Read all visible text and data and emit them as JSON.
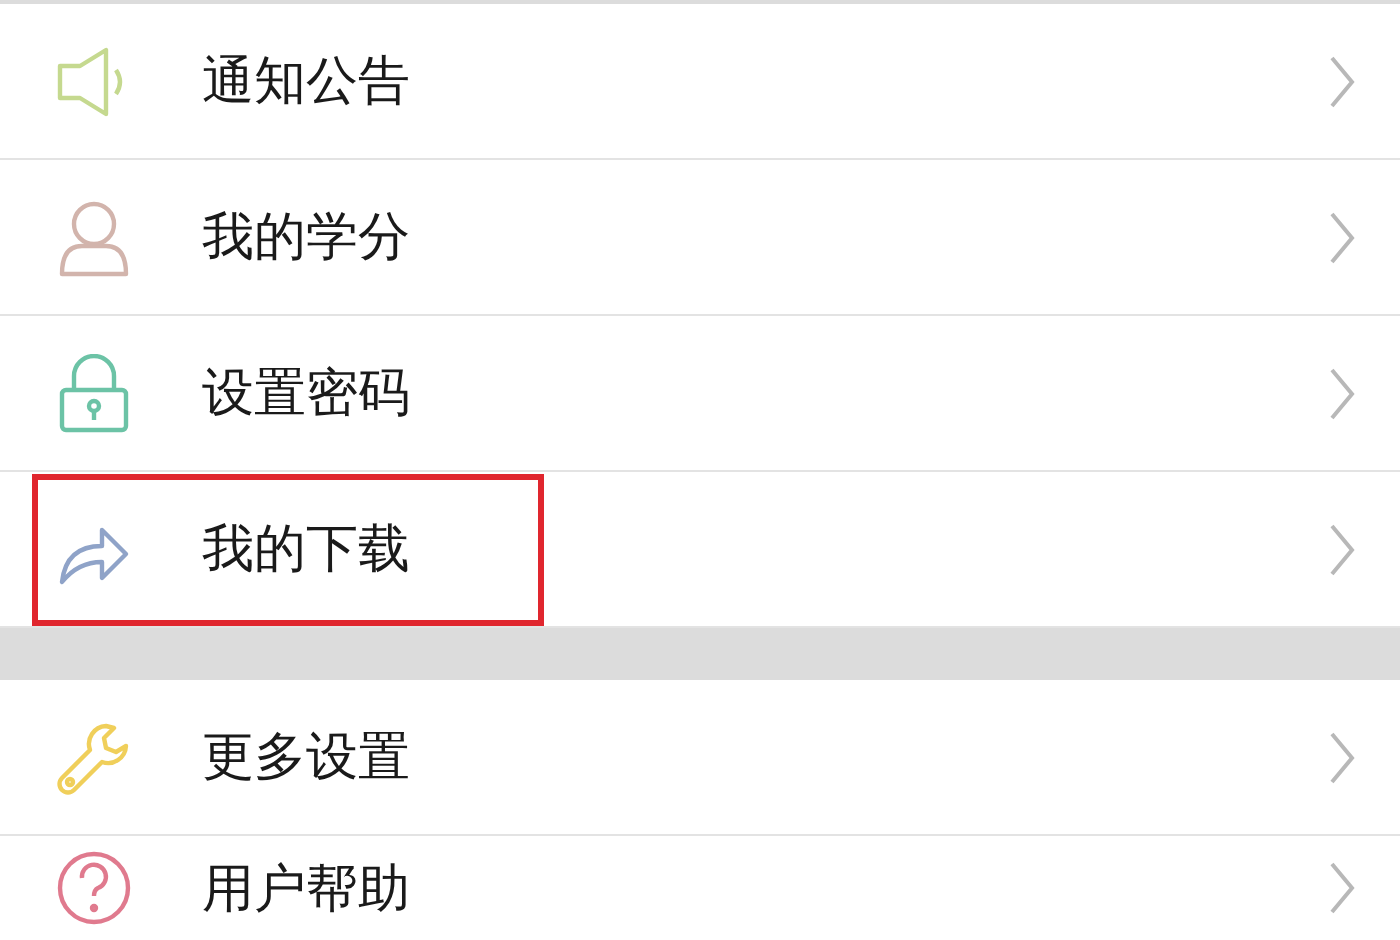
{
  "groups": [
    {
      "items": [
        {
          "kind": "speaker",
          "color": "#c5d98f",
          "label": "通知公告",
          "highlighted": false
        },
        {
          "kind": "person",
          "color": "#d2b4ac",
          "label": "我的学分",
          "highlighted": false
        },
        {
          "kind": "lock",
          "color": "#6cc3a6",
          "label": "设置密码",
          "highlighted": false
        },
        {
          "kind": "share",
          "color": "#8fa3c8",
          "label": "我的下载",
          "highlighted": true
        }
      ]
    },
    {
      "items": [
        {
          "kind": "wrench",
          "color": "#f0cf5a",
          "label": "更多设置",
          "highlighted": false
        },
        {
          "kind": "help",
          "color": "#e07a8e",
          "label": "用户帮助",
          "highlighted": false
        }
      ]
    }
  ]
}
